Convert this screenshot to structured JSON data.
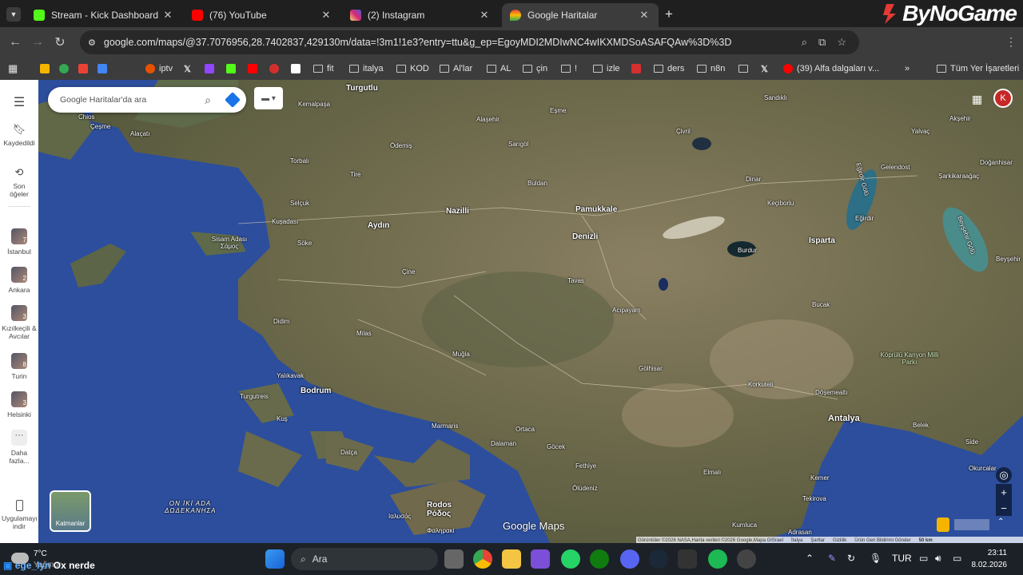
{
  "tabs": [
    {
      "title": "Stream - Kick Dashboard",
      "color": "#53fc18"
    },
    {
      "title": "(76) YouTube",
      "color": "#ff0000"
    },
    {
      "title": "(2) Instagram",
      "color": "#d62976"
    },
    {
      "title": "Google Haritalar",
      "color": "#34a853"
    }
  ],
  "brand": "ByNoGame",
  "address": {
    "url": "google.com/maps/@37.7076956,28.7402837,429130m/data=!3m1!1e3?entry=ttu&g_ep=EgoyMDI2MDIwNC4wIKXMDSoASAFQAw%3D%3D"
  },
  "bookmarks": {
    "items": [
      "iptv",
      "fit",
      "italya",
      "KOD",
      "Al'lar",
      "AL",
      "çin",
      "!",
      "izle",
      "ders",
      "n8n",
      "(39) Alfa dalgaları v...",
      "Tüm Yer İşaretleri"
    ]
  },
  "sidebar": {
    "saved": "Kaydedildi",
    "recent": "Son öğeler",
    "places": [
      {
        "label": "İstanbul",
        "badge": "7"
      },
      {
        "label": "Ankara",
        "badge": "2"
      },
      {
        "label": "Kızılkeçili & Avcılar",
        "badge": "3"
      },
      {
        "label": "Turin",
        "badge": "8"
      },
      {
        "label": "Helsinki",
        "badge": "3"
      }
    ],
    "more": "Daha fazla...",
    "app": "Uygulamayı indir"
  },
  "search": {
    "placeholder": "Google Haritalar'da ara"
  },
  "map": {
    "labels": [
      "Turgutlu",
      "Kemalpaşa",
      "Chios",
      "Çeşme",
      "Alaçatı",
      "Torbalı",
      "Ödemiş",
      "Alaşehir",
      "Eşme",
      "Sandıklı",
      "Çivril",
      "Yalvaç",
      "Akşehir",
      "Tire",
      "Sarıgöl",
      "Buldan",
      "Dinar",
      "Selçuk",
      "Kuşadası",
      "Aydın",
      "Nazilli",
      "Pamukkale",
      "Keçiborlu",
      "Eğirdir",
      "Gelendost",
      "Şarkikaraağaç",
      "Doğanhisar",
      "Söke",
      "Denizli",
      "Isparta",
      "Burdur",
      "Sisam Adası Σάμος",
      "Çine",
      "Tavas",
      "Acıpayam",
      "Bucak",
      "Beyşehir",
      "Didim",
      "Milas",
      "Muğla",
      "Yalıkavak",
      "Bodrum",
      "Turgutreis",
      "Kuş",
      "Gölhisar",
      "Korkuteli",
      "Döşemealtı",
      "Antalya",
      "Belek",
      "Side",
      "Okurcalar",
      "Marmaris",
      "Ortaca",
      "Dalaman",
      "Göcek",
      "Fethiye",
      "Ölüdeniz",
      "Datça",
      "Elmalı",
      "Kemer",
      "Tekirova",
      "Kumluca",
      "Adrasan",
      "Ιαλυσός",
      "Φαληρακί",
      "Eğirdir Gölü",
      "Beyşehir Gölü"
    ],
    "region": "ON İKİ ADA ΔΩΔΕΚΑΝΗΣΑ",
    "park": "Köprülü Kanyon Milli Parkı",
    "rhodes": "Rodos Ρόδος",
    "layers": "Katmanlar",
    "logo": "Google Maps",
    "attribution": [
      "Görüntüler ©2026 NASA,Harita verileri ©2026 Google,Mapa GISrael",
      "İtalya",
      "Şartlar",
      "Gizlilik",
      "Ürün Geri Bildirimi Gönder",
      "50 km"
    ]
  },
  "taskbar": {
    "weather": "7°C",
    "weather_desc": "Yağmur",
    "overlay": "ege_lyn",
    "overlay2": "Ox nerde",
    "search": "Ara",
    "lang": "TUR",
    "time": "23:11",
    "date": "8.02.2026"
  }
}
